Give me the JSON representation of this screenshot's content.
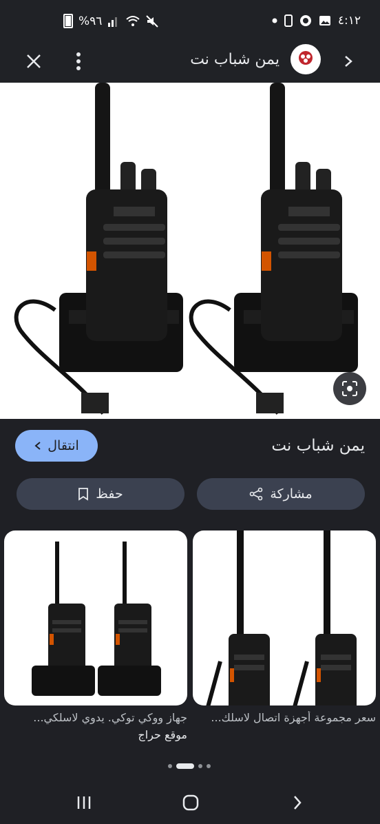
{
  "status_bar": {
    "battery_text": "%٩٦",
    "time": "٤:١٢"
  },
  "top_bar": {
    "site_title": "يمن شباب نت"
  },
  "result": {
    "title": "يمن شباب نت",
    "visit_label": "انتقال",
    "share_label": "مشاركة",
    "save_label": "حفظ"
  },
  "related": [
    {
      "caption": "سعر مجموعة أجهزة اتصال لاسلك...",
      "source": ""
    },
    {
      "caption": "جهاز ووكي توكي. يدوي لاسلكي...",
      "source": "موقع حراج"
    }
  ],
  "colors": {
    "background": "#1f2025",
    "accent_button": "#8ab4f8",
    "pill_button": "#3b4150"
  }
}
